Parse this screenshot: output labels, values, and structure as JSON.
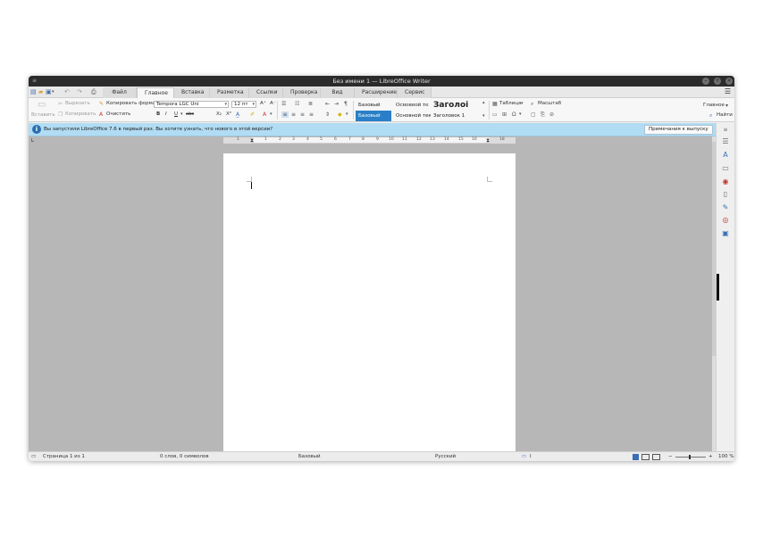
{
  "window": {
    "title": "Без имени 1 — LibreOffice Writer"
  },
  "tabs": [
    {
      "label": "Файл"
    },
    {
      "label": "Главное"
    },
    {
      "label": "Вставка"
    },
    {
      "label": "Разметка"
    },
    {
      "label": "Ссылки"
    },
    {
      "label": "Проверка"
    },
    {
      "label": "Вид"
    },
    {
      "label": "Расширение"
    },
    {
      "label": "Сервис"
    }
  ],
  "active_tab": "Главное",
  "ribbon": {
    "paste": "Вставить",
    "cut": "Вырезать",
    "copy": "Копировать",
    "clone_format": "Копировать формат",
    "clear": "Очистить",
    "font_name": "Tempora LGC Uni",
    "font_size": "12 пт",
    "grow": "A⁺",
    "shrink": "A⁻",
    "bold": "B",
    "italic": "I",
    "underline": "U",
    "strike": "abc",
    "subscript": "X₂",
    "superscript": "X²",
    "styles": {
      "base_label": "Базовый",
      "base_selected": "Базовый",
      "body_text_preview": "Основной тек",
      "body_text": "Основной текст",
      "heading_preview": "Заголоі",
      "heading1": "Заголовок 1"
    },
    "table": "Таблица",
    "zoom": "Масштаб",
    "main_dropdown": "Главное",
    "find": "Найти"
  },
  "infobar": {
    "message": "Вы запустили LibreOffice 7.6 в первый раз. Вы хотите узнать, что нового в этой версии?",
    "button": "Примечания к выпуску"
  },
  "ruler": {
    "left_marker": "1",
    "labels": [
      "1",
      "2",
      "3",
      "4",
      "5",
      "6",
      "7",
      "8",
      "9",
      "10",
      "11",
      "12",
      "13",
      "14",
      "15",
      "16",
      "17",
      "18"
    ]
  },
  "status": {
    "page": "Страница 1 из 1",
    "words": "0 слов, 0 символов",
    "page_style": "Базовый",
    "language": "Русский",
    "zoom": "100 %"
  },
  "colors": {
    "infobar": "#b1dcf3",
    "accent": "#2a7fc8",
    "titlebar": "#2b2b2b"
  }
}
